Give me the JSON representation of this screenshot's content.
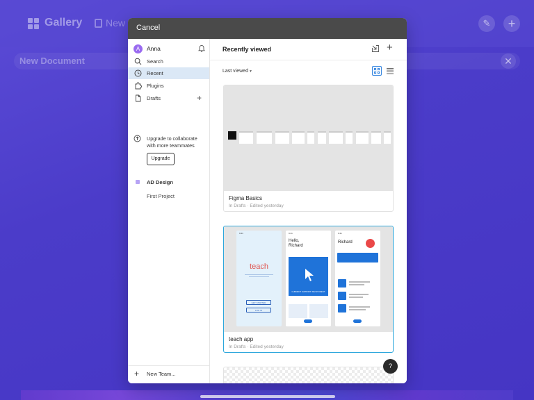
{
  "background": {
    "gallery_label": "Gallery",
    "new_label": "New",
    "document_label": "New Document"
  },
  "modal": {
    "cancel_label": "Cancel"
  },
  "sidebar": {
    "user": {
      "initial": "A",
      "name": "Anna"
    },
    "nav": [
      {
        "label": "Search",
        "icon": "search-icon"
      },
      {
        "label": "Recent",
        "icon": "clock-icon",
        "active": true
      },
      {
        "label": "Plugins",
        "icon": "plugin-icon"
      },
      {
        "label": "Drafts",
        "icon": "file-icon"
      }
    ],
    "upgrade_text": "Upgrade to collaborate with more teammates",
    "upgrade_button": "Upgrade",
    "team_name": "AD Design",
    "project_name": "First Project",
    "new_team_label": "New Team..."
  },
  "main": {
    "title": "Recently viewed",
    "sort_label": "Last viewed",
    "files": [
      {
        "name": "Figma Basics",
        "meta": "In Drafts · Edited yesterday"
      },
      {
        "name": "teach app",
        "meta": "In Drafts · Edited yesterday",
        "selected": true
      }
    ],
    "teach_thumbnail": {
      "logo": "teach",
      "hello_line1": "Hello,",
      "hello_line2": "Richard",
      "card_text": "CURRENT SUPPORT: SIM STUDENT",
      "profile_name": "Richard",
      "get_started": "GET STARTED",
      "log_in": "LOG IN"
    }
  },
  "help_label": "?",
  "colors": {
    "accent": "#3a88e0",
    "selected_border": "#2aa6dc",
    "background": "#4b3cc9",
    "header": "#4a4a4a"
  }
}
